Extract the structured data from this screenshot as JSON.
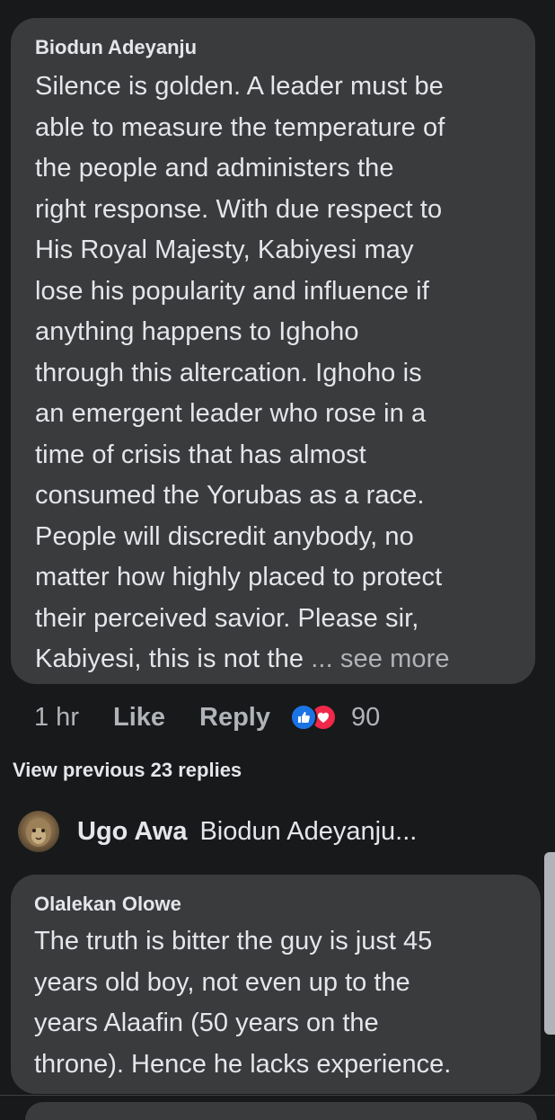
{
  "comment": {
    "author": "Biodun Adeyanju",
    "text": "Silence is golden. A leader must be\nable to measure the temperature of\nthe people and administers the\nright response. With due respect to\nHis Royal Majesty, Kabiyesi may\nlose his popularity and influence if\nanything happens to Ighoho\nthrough this altercation. Ighoho is\nan emergent leader who rose in a\ntime of crisis that has almost\nconsumed the Yorubas as a race.\nPeople  will discredit anybody, no\nmatter how highly placed to protect\ntheir perceived savior. Please sir,\nKabiyesi, this is not the ",
    "see_more": "... see more",
    "time": "1 hr",
    "like_label": "Like",
    "reply_label": "Reply",
    "reaction_icons": [
      "like-icon",
      "love-icon"
    ],
    "reaction_count": "90"
  },
  "view_previous": "View previous 23 replies",
  "reply_preview": {
    "name": "Ugo Awa",
    "text": "Biodun Adeyanju..."
  },
  "reply": {
    "author": "Olalekan Olowe",
    "text": "The truth is bitter the guy is just 45\nyears old boy, not even up to the\nyears Alaafin (50 years on the\nthrone). Hence he lacks experience."
  },
  "colors": {
    "background": "#18191a",
    "bubble": "#3a3b3c",
    "text": "#e4e6eb",
    "secondary_text": "#b0b3b8",
    "like_blue": "#1b74e4",
    "love_red": "#f02849"
  }
}
